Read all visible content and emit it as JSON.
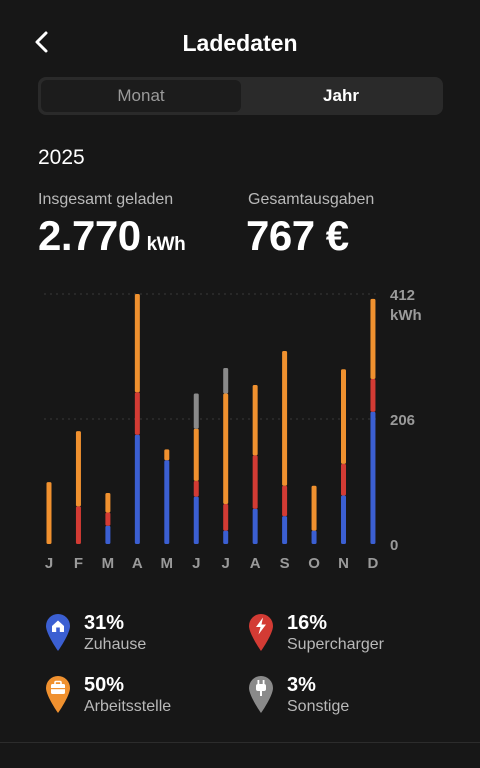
{
  "header": {
    "title": "Ladedaten",
    "back_icon": "chevron-left-icon"
  },
  "tabs": [
    {
      "label": "Monat",
      "selected": false
    },
    {
      "label": "Jahr",
      "selected": true
    }
  ],
  "year": "2025",
  "metrics": {
    "total_label": "Insgesamt geladen",
    "total_value": "2.770",
    "total_unit": "kWh",
    "cost_label": "Gesamtausgaben",
    "cost_value": "767 €"
  },
  "colors": {
    "home": "#3b5fd2",
    "supercharger": "#d33b34",
    "work": "#f0912f",
    "other": "#8a8a8a"
  },
  "chart_data": {
    "type": "bar",
    "stacked": true,
    "categories": [
      "J",
      "F",
      "M",
      "A",
      "M",
      "J",
      "J",
      "A",
      "S",
      "O",
      "N",
      "D"
    ],
    "series": [
      {
        "name": "Zuhause",
        "color": "#3b5fd2",
        "values": [
          0,
          0,
          30,
          180,
          138,
          78,
          22,
          58,
          46,
          22,
          80,
          218
        ]
      },
      {
        "name": "Supercharger",
        "color": "#d33b34",
        "values": [
          0,
          62,
          22,
          70,
          0,
          26,
          44,
          88,
          50,
          0,
          52,
          54
        ]
      },
      {
        "name": "Arbeitsstelle",
        "color": "#f0912f",
        "values": [
          102,
          124,
          32,
          162,
          18,
          86,
          182,
          116,
          222,
          74,
          156,
          132
        ]
      },
      {
        "name": "Sonstige",
        "color": "#8a8a8a",
        "values": [
          0,
          0,
          0,
          0,
          0,
          58,
          42,
          0,
          0,
          0,
          0,
          0
        ]
      }
    ],
    "ylim": [
      0,
      412
    ],
    "y_ticks": [
      {
        "value": 412,
        "label": "412"
      },
      {
        "value": 206,
        "label": "206"
      },
      {
        "value": 0,
        "label": "0"
      }
    ],
    "y_unit": "kWh",
    "grid": "dotted"
  },
  "legend": [
    {
      "pct": "31%",
      "name": "Zuhause",
      "icon": "home-icon",
      "color": "#3b5fd2"
    },
    {
      "pct": "16%",
      "name": "Supercharger",
      "icon": "lightning-icon",
      "color": "#d33b34"
    },
    {
      "pct": "50%",
      "name": "Arbeitsstelle",
      "icon": "briefcase-icon",
      "color": "#f0912f"
    },
    {
      "pct": "3%",
      "name": "Sonstige",
      "icon": "plug-icon",
      "color": "#8a8a8a"
    }
  ]
}
